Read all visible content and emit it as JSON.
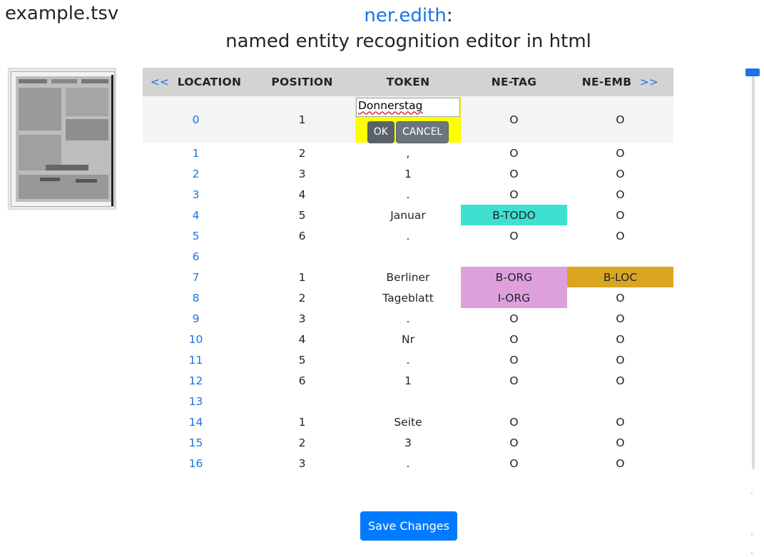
{
  "file": {
    "name": "example.tsv"
  },
  "title": {
    "app_link": "ner.edith",
    "colon": ":",
    "subtitle": "named entity recognition editor in html"
  },
  "table": {
    "nav_prev": "<<",
    "nav_next": ">>",
    "headers": [
      "LOCATION",
      "POSITION",
      "TOKEN",
      "NE-TAG",
      "NE-EMB"
    ],
    "editor": {
      "value": "Donnerstag",
      "ok_label": "OK",
      "cancel_label": "CANCEL"
    },
    "rows": [
      {
        "loc": "0",
        "pos": "1",
        "token": "Donnerstag",
        "tag": "O",
        "emb": "O"
      },
      {
        "loc": "1",
        "pos": "2",
        "token": ",",
        "tag": "O",
        "emb": "O"
      },
      {
        "loc": "2",
        "pos": "3",
        "token": "1",
        "tag": "O",
        "emb": "O"
      },
      {
        "loc": "3",
        "pos": "4",
        "token": ".",
        "tag": "O",
        "emb": "O"
      },
      {
        "loc": "4",
        "pos": "5",
        "token": "Januar",
        "tag": "B-TODO",
        "emb": "O"
      },
      {
        "loc": "5",
        "pos": "6",
        "token": ".",
        "tag": "O",
        "emb": "O"
      },
      {
        "loc": "6",
        "pos": "",
        "token": "",
        "tag": "",
        "emb": ""
      },
      {
        "loc": "7",
        "pos": "1",
        "token": "Berliner",
        "tag": "B-ORG",
        "emb": "B-LOC"
      },
      {
        "loc": "8",
        "pos": "2",
        "token": "Tageblatt",
        "tag": "I-ORG",
        "emb": "O"
      },
      {
        "loc": "9",
        "pos": "3",
        "token": ".",
        "tag": "O",
        "emb": "O"
      },
      {
        "loc": "10",
        "pos": "4",
        "token": "Nr",
        "tag": "O",
        "emb": "O"
      },
      {
        "loc": "11",
        "pos": "5",
        "token": ".",
        "tag": "O",
        "emb": "O"
      },
      {
        "loc": "12",
        "pos": "6",
        "token": "1",
        "tag": "O",
        "emb": "O"
      },
      {
        "loc": "13",
        "pos": "",
        "token": "",
        "tag": "",
        "emb": ""
      },
      {
        "loc": "14",
        "pos": "1",
        "token": "Seite",
        "tag": "O",
        "emb": "O"
      },
      {
        "loc": "15",
        "pos": "2",
        "token": "3",
        "tag": "O",
        "emb": "O"
      },
      {
        "loc": "16",
        "pos": "3",
        "token": ".",
        "tag": "O",
        "emb": "O"
      }
    ]
  },
  "save": {
    "label": "Save Changes"
  },
  "colors": {
    "link": "#1a73e8",
    "primary_button": "#007bff",
    "editor_highlight": "#ffff00",
    "tag_todo": "#40e0d0",
    "tag_org": "#dda0dd",
    "tag_loc": "#daa520",
    "header_bg": "#d3d3d3"
  },
  "icons": {
    "page_thumbnail": "document-scan-thumbnail",
    "zoom_slider": "vertical-slider"
  }
}
